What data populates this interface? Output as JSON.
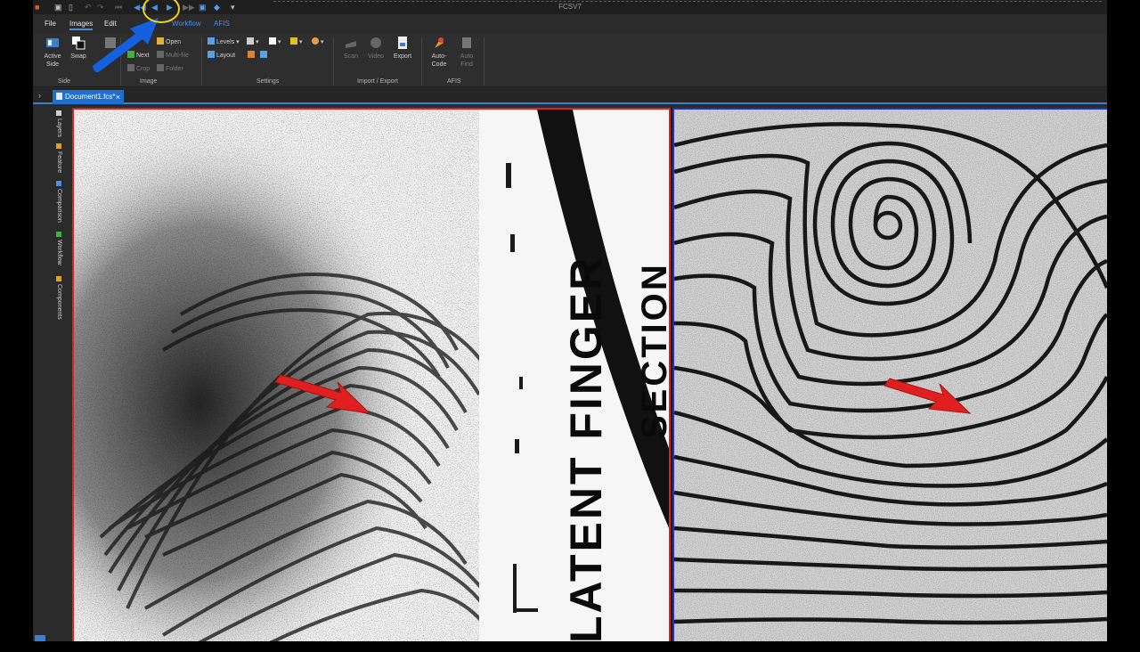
{
  "app": {
    "title": "FCSV7"
  },
  "menu": [
    {
      "label": "File"
    },
    {
      "label": "Images"
    },
    {
      "label": "Edit"
    },
    {
      "label": "Workflow"
    },
    {
      "label": "AFIS"
    }
  ],
  "ribbon": {
    "side": {
      "group_label": "Side",
      "active_side": "Active\nSide",
      "swap": "Swap"
    },
    "image": {
      "group_label": "Image",
      "open": "Open",
      "next": "Next",
      "multi_file": "Multi-file",
      "crop": "Crop",
      "folder": "Folder"
    },
    "settings": {
      "group_label": "Settings",
      "levels": "Levels",
      "layout": "Layout"
    },
    "import_export": {
      "group_label": "Import / Export",
      "scan": "Scan",
      "video": "Video",
      "export": "Export"
    },
    "afis": {
      "group_label": "AFIS",
      "auto_code": "Auto-\nCode",
      "auto_find": "Auto\nFind"
    }
  },
  "document_tab": {
    "label": "Document1.fcs",
    "modified": "*",
    "close": "×"
  },
  "sidebar": [
    {
      "label": "Layers",
      "color": "#cfcfcf"
    },
    {
      "label": "Feature",
      "color": "#e0a020"
    },
    {
      "label": "Comparison",
      "color": "#4a8fe0"
    },
    {
      "label": "Workflow",
      "color": "#40b040"
    },
    {
      "label": "Components",
      "color": "#e0a020"
    }
  ],
  "latent_card_text": {
    "line1": "LATENT FINGER",
    "line2": "SECTION"
  },
  "colors": {
    "accent": "#3b7fd0",
    "latent_border": "#e02020",
    "known_border": "#1a2fd8",
    "arrow_red": "#e02020",
    "annotation_blue": "#1560e0",
    "annotation_yellow": "#f0d020"
  }
}
